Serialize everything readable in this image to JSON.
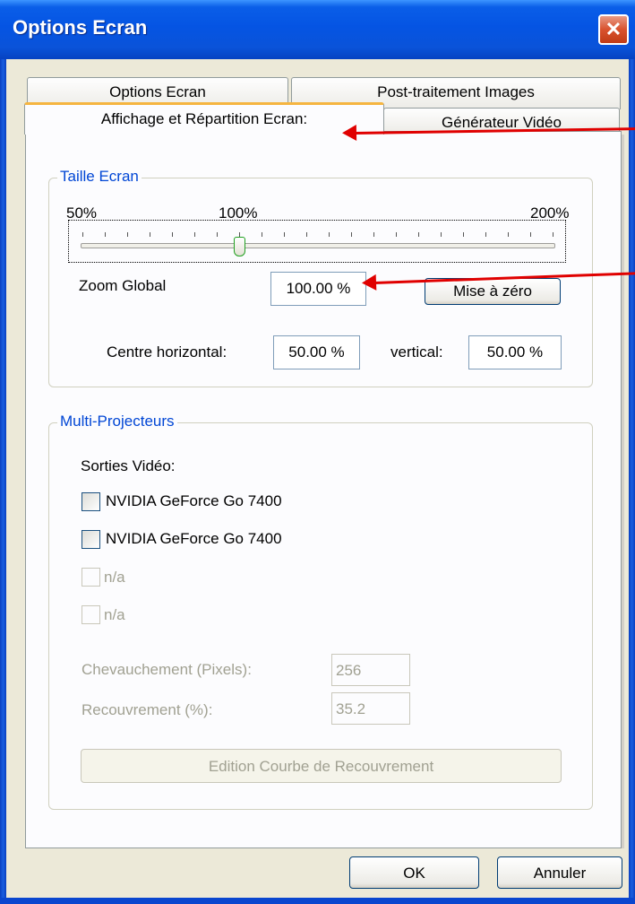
{
  "window": {
    "title": "Options Ecran",
    "close_glyph": "✕"
  },
  "tabs": [
    {
      "label": "Options Ecran"
    },
    {
      "label": "Post-traitement Images"
    },
    {
      "label": "Affichage et Répartition Ecran:"
    },
    {
      "label": "Générateur Vidéo"
    }
  ],
  "taille_ecran": {
    "legend": "Taille Ecran",
    "scale_min": "50%",
    "scale_mid": "100%",
    "scale_max": "200%",
    "zoom_level_percent": 100,
    "zoom_label": "Zoom Global",
    "zoom_value": "100.00 %",
    "reset_label": "Mise à zéro",
    "centre_h_label": "Centre horizontal:",
    "centre_h_value": "50.00 %",
    "vertical_label": "vertical:",
    "vertical_value": "50.00 %"
  },
  "multi_projecteurs": {
    "legend": "Multi-Projecteurs",
    "outputs_label": "Sorties Vidéo:",
    "outputs": [
      {
        "label": "NVIDIA GeForce Go 7400",
        "enabled": true
      },
      {
        "label": "NVIDIA GeForce Go 7400",
        "enabled": true
      },
      {
        "label": "n/a",
        "enabled": false
      },
      {
        "label": "n/a",
        "enabled": false
      }
    ],
    "overlap_label": "Chevauchement (Pixels):",
    "overlap_value": "256",
    "recovery_label": "Recouvrement (%):",
    "recovery_value": "35.2",
    "edit_curve_label": "Edition Courbe de Recouvrement"
  },
  "footer": {
    "ok_label": "OK",
    "cancel_label": "Annuler"
  },
  "colors": {
    "annotation_arrow": "#e00000",
    "group_legend": "#0046d5",
    "title_bar": "#0554e3"
  }
}
